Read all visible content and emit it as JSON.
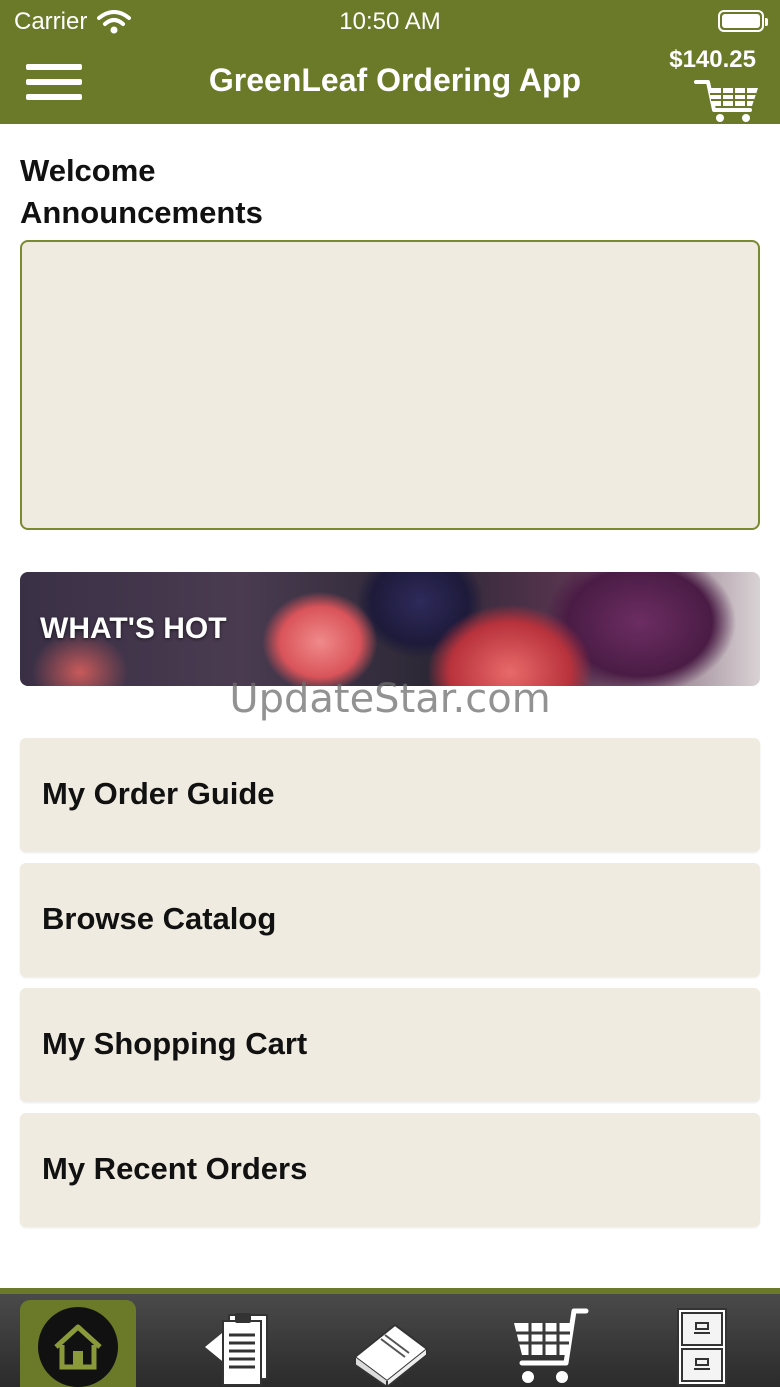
{
  "status_bar": {
    "carrier": "Carrier",
    "time": "10:50 AM"
  },
  "header": {
    "title": "GreenLeaf Ordering App",
    "cart_total": "$140.25"
  },
  "welcome": {
    "line1": "Welcome",
    "line2": "Announcements"
  },
  "banner": {
    "label": "WHAT'S HOT"
  },
  "watermark": "UpdateStar.com",
  "nav": {
    "items": [
      {
        "label": "My Order Guide"
      },
      {
        "label": "Browse Catalog"
      },
      {
        "label": "My Shopping Cart"
      },
      {
        "label": "My Recent Orders"
      }
    ]
  },
  "tabs": [
    "home-icon",
    "order-guide-icon",
    "catalog-book-icon",
    "shopping-cart-icon",
    "file-cabinet-icon"
  ],
  "colors": {
    "brand_green": "#6b7a28",
    "card_beige": "#efebe0",
    "tab_bar_dark": "#2b2b2b"
  }
}
